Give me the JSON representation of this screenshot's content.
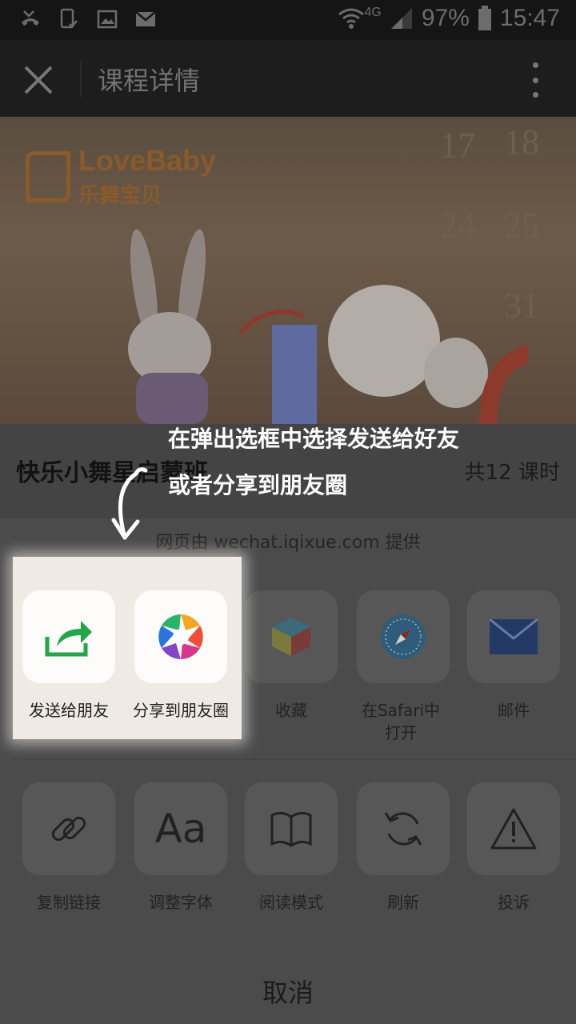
{
  "status_bar": {
    "network": "4G",
    "battery": "97%",
    "time": "15:47"
  },
  "nav": {
    "title": "课程详情"
  },
  "hero": {
    "logo_en": "LoveBaby",
    "logo_cn": "乐舞宝贝",
    "calendar_numbers": [
      "17",
      "18",
      "24",
      "25",
      "31"
    ]
  },
  "course": {
    "title": "快乐小舞星启蒙班",
    "hours": "共12 课时"
  },
  "annotation": {
    "line1": "在弹出选框中选择发送给好友",
    "line2": "或者分享到朋友圈"
  },
  "sheet": {
    "provider": "网页由 wechat.iqixue.com 提供",
    "row1": [
      {
        "label": "发送给朋友",
        "icon": "share-arrow-icon"
      },
      {
        "label": "分享到朋友圈",
        "icon": "moments-icon"
      },
      {
        "label": "收藏",
        "icon": "favorite-cube-icon"
      },
      {
        "label": "在Safari中打开",
        "icon": "safari-compass-icon"
      },
      {
        "label": "邮件",
        "icon": "mail-icon"
      }
    ],
    "row2": [
      {
        "label": "复制链接",
        "icon": "link-icon"
      },
      {
        "label": "调整字体",
        "icon": "font-icon"
      },
      {
        "label": "阅读模式",
        "icon": "book-icon"
      },
      {
        "label": "刷新",
        "icon": "refresh-icon"
      },
      {
        "label": "投诉",
        "icon": "warning-icon"
      }
    ],
    "cancel": "取消"
  },
  "colors": {
    "share_green": "#21a64a",
    "highlight_bg": "#efeae4"
  }
}
